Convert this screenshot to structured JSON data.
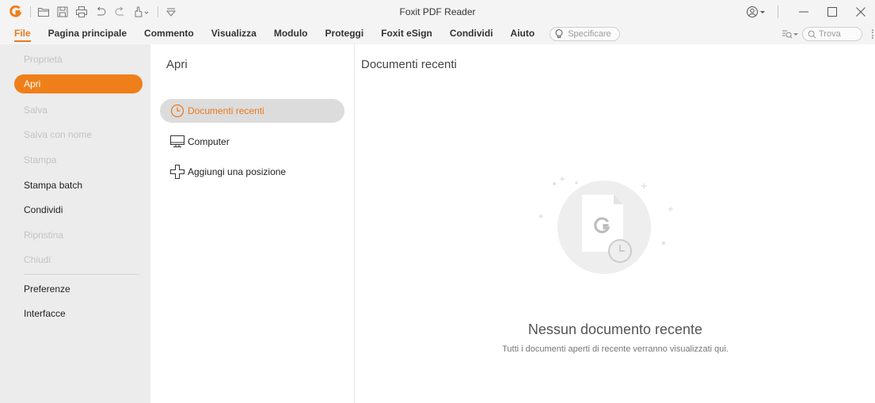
{
  "app": {
    "title": "Foxit PDF Reader",
    "accent": "#ef7f1a"
  },
  "quick_access": [
    "foxit-logo",
    "open-folder-icon",
    "save-icon",
    "print-icon",
    "undo-icon",
    "redo-icon",
    "hand-tool-icon",
    "customize-dropdown-icon"
  ],
  "ribbon": {
    "tabs": [
      "File",
      "Pagina principale",
      "Commento",
      "Visualizza",
      "Modulo",
      "Proteggi",
      "Foxit eSign",
      "Condividi",
      "Aiuto"
    ],
    "active_tab": "File",
    "tell_me_placeholder": "Specificare",
    "find_placeholder": "Trova"
  },
  "backstage": {
    "nav": [
      {
        "label": "Proprietà",
        "state": "disabled"
      },
      {
        "label": "Apri",
        "state": "active"
      },
      {
        "label": "Salva",
        "state": "disabled"
      },
      {
        "label": "Salva con nome",
        "state": "disabled"
      },
      {
        "label": "Stampa",
        "state": "disabled"
      },
      {
        "label": "Stampa batch",
        "state": "enabled"
      },
      {
        "label": "Condividi",
        "state": "enabled"
      },
      {
        "label": "Ripristina",
        "state": "disabled"
      },
      {
        "label": "Chiudi",
        "state": "disabled"
      },
      {
        "label": "Preferenze",
        "state": "enabled"
      },
      {
        "label": "Interfacce",
        "state": "enabled"
      }
    ],
    "open_panel": {
      "title": "Apri",
      "options": [
        {
          "label": "Documenti recenti",
          "icon": "clock-icon",
          "selected": true
        },
        {
          "label": "Computer",
          "icon": "computer-icon",
          "selected": false
        },
        {
          "label": "Aggiungi una posizione",
          "icon": "add-location-icon",
          "selected": false
        }
      ]
    },
    "recent": {
      "title": "Documenti recenti",
      "empty_title": "Nessun documento recente",
      "empty_subtitle": "Tutti i documenti aperti di recente verranno visualizzati qui."
    }
  }
}
